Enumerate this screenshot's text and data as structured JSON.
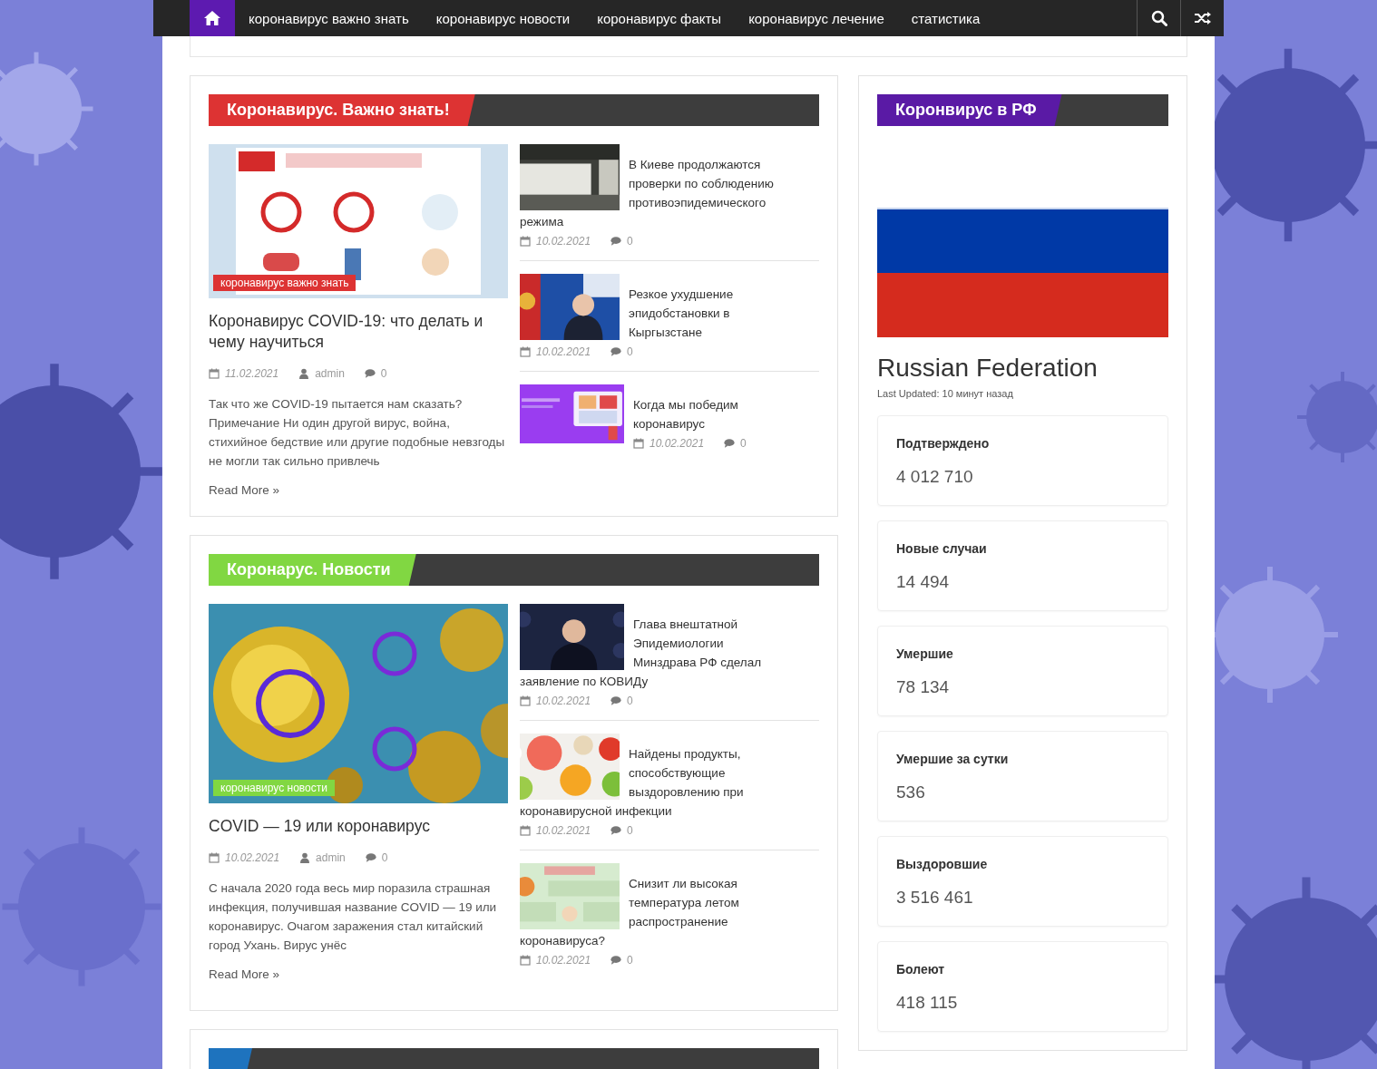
{
  "nav": {
    "items": [
      {
        "kind": "home",
        "selected": true
      },
      {
        "kind": "link",
        "label": "коронавирус важно знать",
        "selected": false
      },
      {
        "kind": "link",
        "label": "коронавирус новости",
        "selected": false
      },
      {
        "kind": "link",
        "label": "коронавирус факты",
        "selected": false
      },
      {
        "kind": "link",
        "label": "коронавирус лечение",
        "selected": false
      },
      {
        "kind": "link",
        "label": "статистика",
        "selected": false
      }
    ]
  },
  "sections": [
    {
      "title": "Коронавирус. Важно знать!",
      "color": "#dd3333",
      "featured": {
        "category": "коронавирус важно знать",
        "title": "Коронавирус COVID-19: что делать и чему научиться",
        "date": "11.02.2021",
        "author": "admin",
        "comments": "0",
        "excerpt": "Так что же COVID-19 пытается нам сказать? Примечание Ни один другой вирус, война, стихийное бедствие или другие подобные невзгоды не могли так сильно привлечь",
        "read_more": "Read More »"
      },
      "posts": [
        {
          "title": "В Киеве продолжаются проверки по соблюдению противоэпидемического режима",
          "date": "10.02.2021",
          "comments": "0"
        },
        {
          "title": "Резкое ухудшение эпидобстановки в Кыргызстане",
          "date": "10.02.2021",
          "comments": "0"
        },
        {
          "title": "Когда мы победим коронавирус",
          "date": "10.02.2021",
          "comments": "0"
        }
      ]
    },
    {
      "title": "Коронарус. Новости",
      "color": "#81d742",
      "featured": {
        "category": "коронавирус новости",
        "title": "COVID — 19 или коронавирус",
        "date": "10.02.2021",
        "author": "admin",
        "comments": "0",
        "excerpt": "С начала 2020 года весь мир поразила страшная инфекция, получившая название COVID — 19 или коронавирус. Очагом заражения стал китайский город Ухань. Вирус унёс",
        "read_more": "Read More »"
      },
      "posts": [
        {
          "title": "Глава внештатной Эпидемиологии Минздрава РФ сделал заявление по КОВИДу",
          "date": "10.02.2021",
          "comments": "0"
        },
        {
          "title": "Найдены продукты, способствующие выздоровлению при коронавирусной инфекции",
          "date": "10.02.2021",
          "comments": "0"
        },
        {
          "title": "Снизит ли высокая температура летом распространение коронавируса?",
          "date": "10.02.2021",
          "comments": "0"
        }
      ]
    },
    {
      "color": "#1e73be"
    }
  ],
  "sidebar": {
    "title": "Коронвирус в РФ",
    "color": "#5a1aa5",
    "country": "Russian Federation",
    "last_updated": "Last Updated: 10 минут назад",
    "stats": [
      {
        "label": "Подтверждено",
        "value": "4 012 710"
      },
      {
        "label": "Новые случаи",
        "value": "14 494"
      },
      {
        "label": "Умершие",
        "value": "78 134"
      },
      {
        "label": "Умершие за сутки",
        "value": "536"
      },
      {
        "label": "Выздоровшие",
        "value": "3 516 461"
      },
      {
        "label": "Болеют",
        "value": "418 115"
      }
    ]
  }
}
